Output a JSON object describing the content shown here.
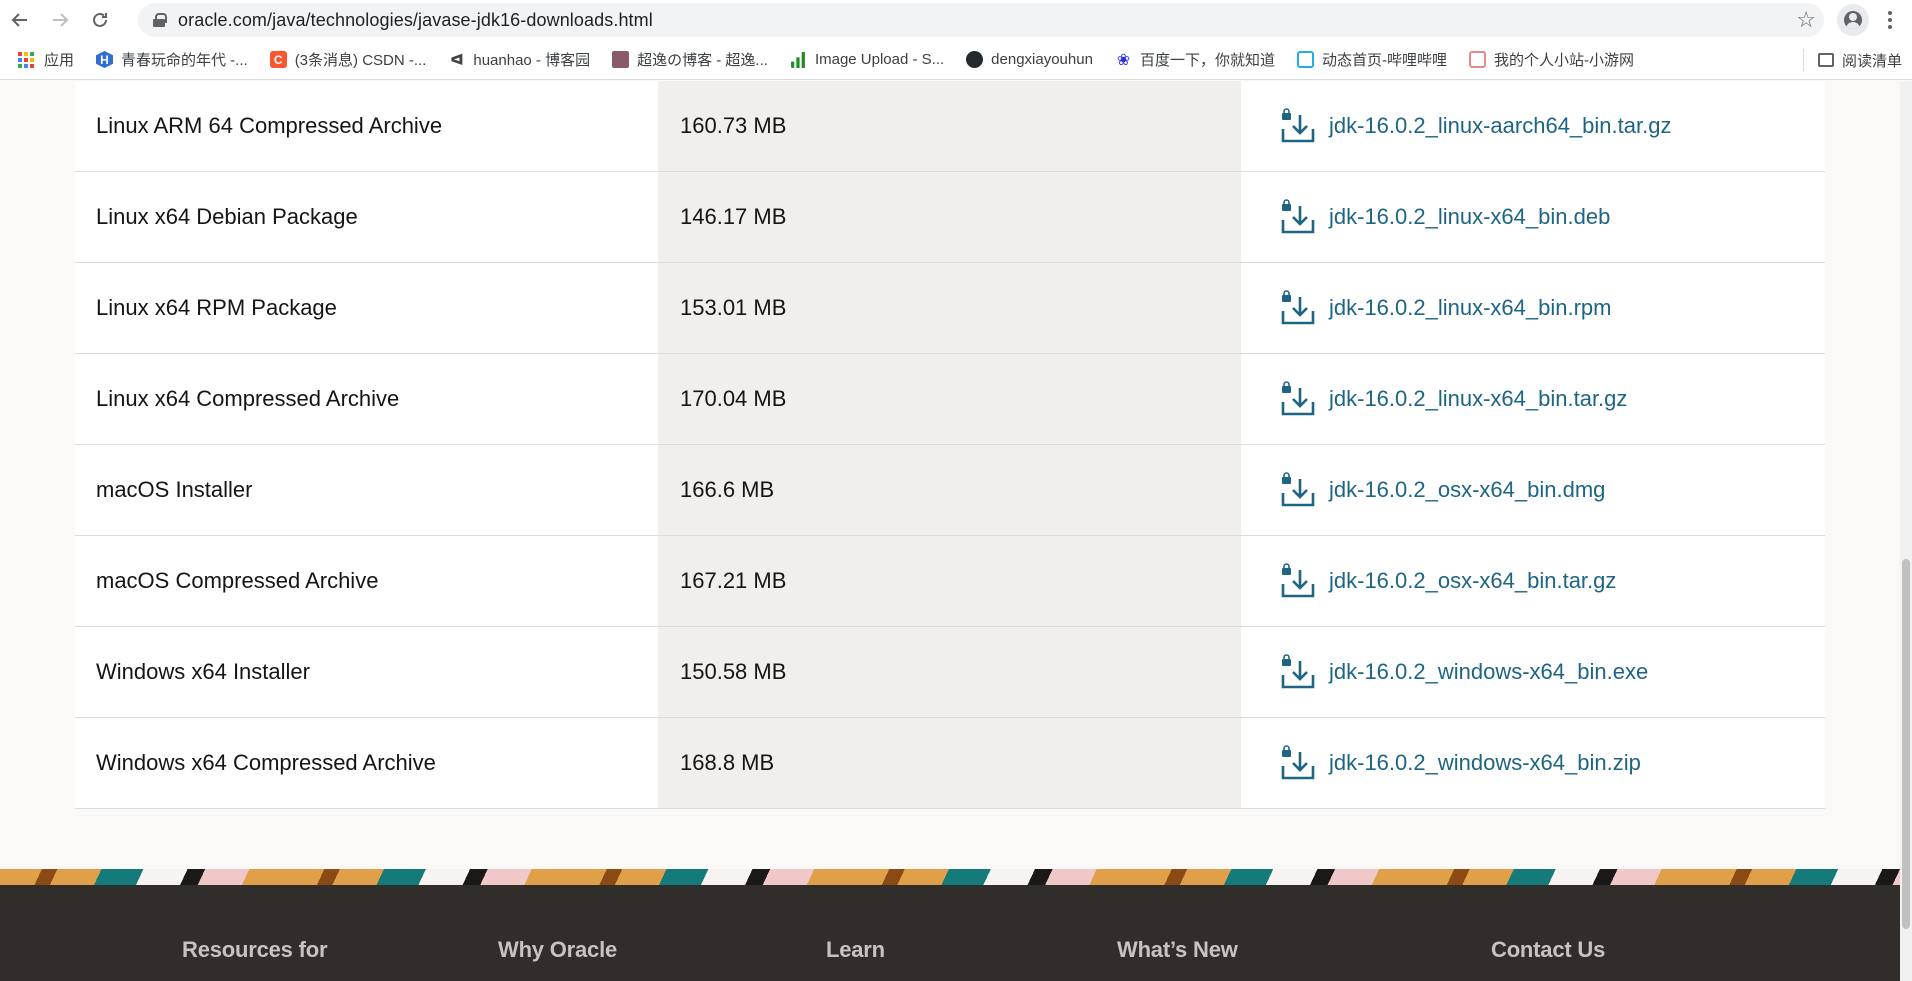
{
  "browser": {
    "url": "oracle.com/java/technologies/javase-jdk16-downloads.html",
    "bookmarks": [
      {
        "label": "应用",
        "icon": "apps-grid-icon",
        "color": "#4285f4"
      },
      {
        "label": "青春玩命的年代 -...",
        "icon": "hexagon-h-icon",
        "color": "#2f6fd1"
      },
      {
        "label": "(3条消息) CSDN -...",
        "icon": "csdn-c-icon",
        "color": "#fc5531"
      },
      {
        "label": "huanhao - 博客园",
        "icon": "cnblogs-icon",
        "color": "#444444"
      },
      {
        "label": "超逸の博客 - 超逸...",
        "icon": "avatar-icon",
        "color": "#8a5a6a"
      },
      {
        "label": "Image Upload - S...",
        "icon": "bar-chart-icon",
        "color": "#1f8b24"
      },
      {
        "label": "dengxiayouhun",
        "icon": "github-icon",
        "color": "#24292e"
      },
      {
        "label": "百度一下，你就知道",
        "icon": "baidu-paw-icon",
        "color": "#2932e1"
      },
      {
        "label": "动态首页-哔哩哔哩",
        "icon": "bilibili-tv-icon",
        "color": "#23ade5"
      },
      {
        "label": "我的个人小站-小游网",
        "icon": "page-icon",
        "color": "#e88a8a"
      }
    ],
    "reading_list": "阅读清单"
  },
  "downloads": [
    {
      "product": "Linux ARM 64 Compressed Archive",
      "size": "160.73 MB",
      "file": "jdk-16.0.2_linux-aarch64_bin.tar.gz"
    },
    {
      "product": "Linux x64 Debian Package",
      "size": "146.17 MB",
      "file": "jdk-16.0.2_linux-x64_bin.deb"
    },
    {
      "product": "Linux x64 RPM Package",
      "size": "153.01 MB",
      "file": "jdk-16.0.2_linux-x64_bin.rpm"
    },
    {
      "product": "Linux x64 Compressed Archive",
      "size": "170.04 MB",
      "file": "jdk-16.0.2_linux-x64_bin.tar.gz"
    },
    {
      "product": "macOS Installer",
      "size": "166.6 MB",
      "file": "jdk-16.0.2_osx-x64_bin.dmg"
    },
    {
      "product": "macOS Compressed Archive",
      "size": "167.21 MB",
      "file": "jdk-16.0.2_osx-x64_bin.tar.gz"
    },
    {
      "product": "Windows x64 Installer",
      "size": "150.58 MB",
      "file": "jdk-16.0.2_windows-x64_bin.exe"
    },
    {
      "product": "Windows x64 Compressed Archive",
      "size": "168.8 MB",
      "file": "jdk-16.0.2_windows-x64_bin.zip"
    }
  ],
  "footer": {
    "columns": [
      "Resources for",
      "Why Oracle",
      "Learn",
      "What’s New",
      "Contact Us"
    ]
  },
  "colors": {
    "link": "#1e6584",
    "footer_bg": "#312d2a",
    "size_column_bg": "#f1efed"
  }
}
